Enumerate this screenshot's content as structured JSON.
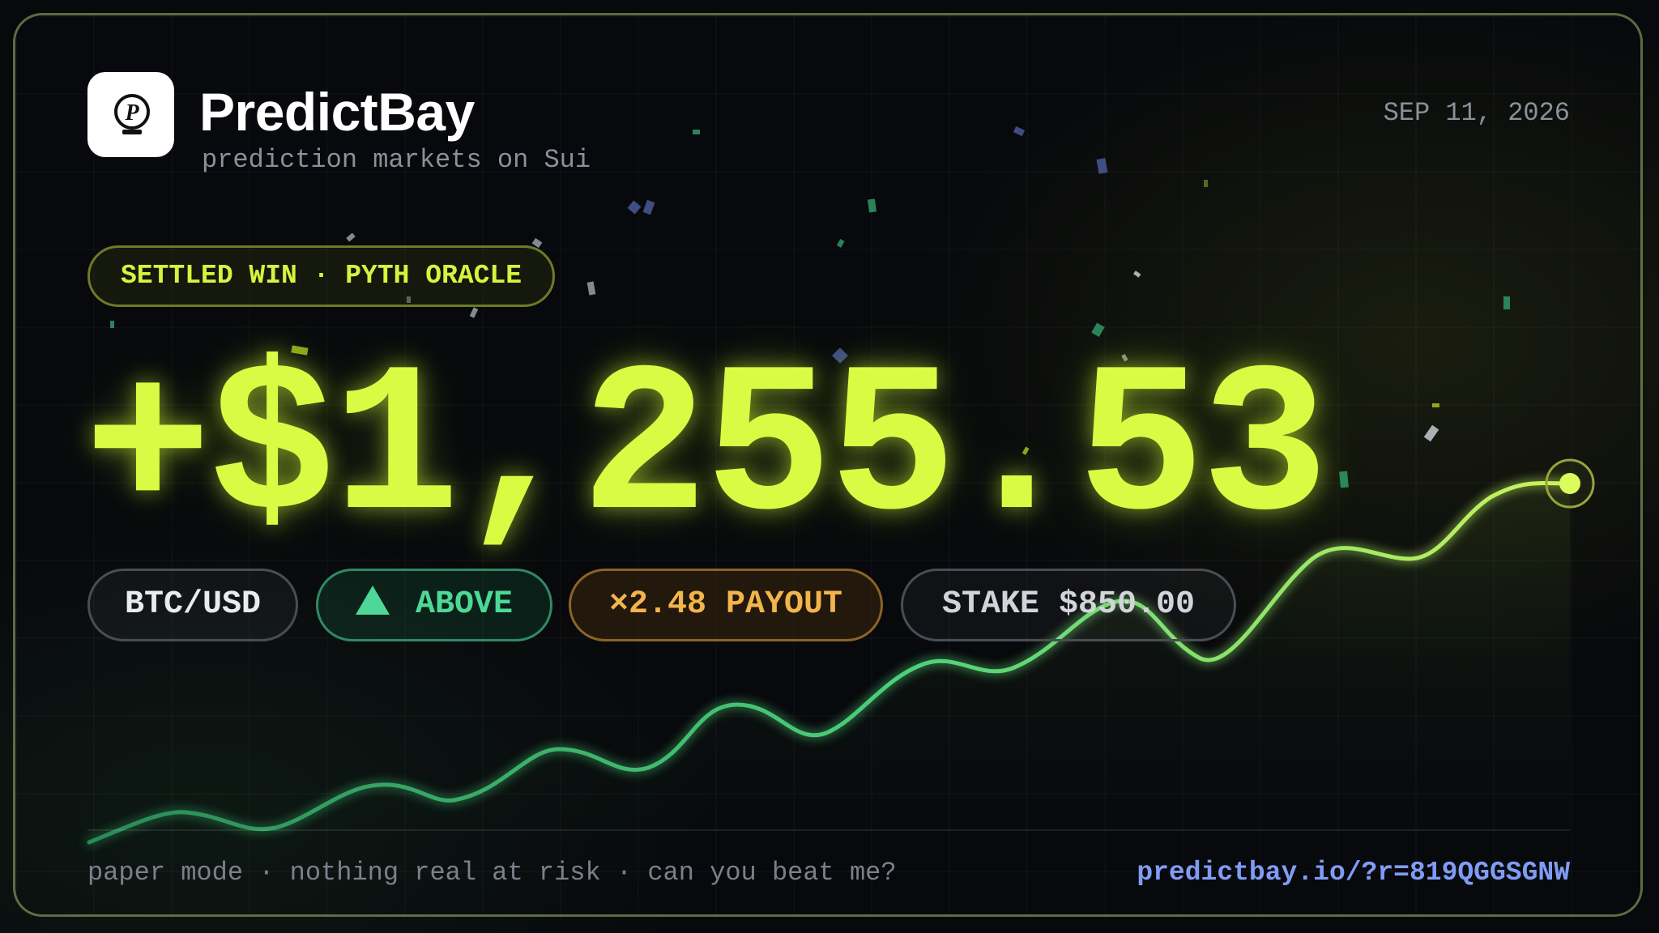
{
  "brand": {
    "name": "PredictBay",
    "tagline": "prediction markets on Sui",
    "logo_icon": "predictbay-logo-icon"
  },
  "date": "SEP 11, 2026",
  "status_badge": "SETTLED WIN · PYTH ORACLE",
  "result_amount": "+$1,255.53",
  "chips": {
    "pair": "BTC/USD",
    "direction_icon": "triangle-up-icon",
    "direction": "ABOVE",
    "payout": "×2.48 PAYOUT",
    "stake": "STAKE $850.00"
  },
  "footer": {
    "disclaimer": "paper mode · nothing real at risk · can you beat me?",
    "referral_link": "predictbay.io/?r=819QGGSGNW"
  },
  "colors": {
    "accent": "#d9fb43",
    "up": "#4ed897",
    "payout": "#f2b44c",
    "link": "#7f9cf5",
    "line_start": "#2e9a5c",
    "line_end": "#c7f55a"
  }
}
